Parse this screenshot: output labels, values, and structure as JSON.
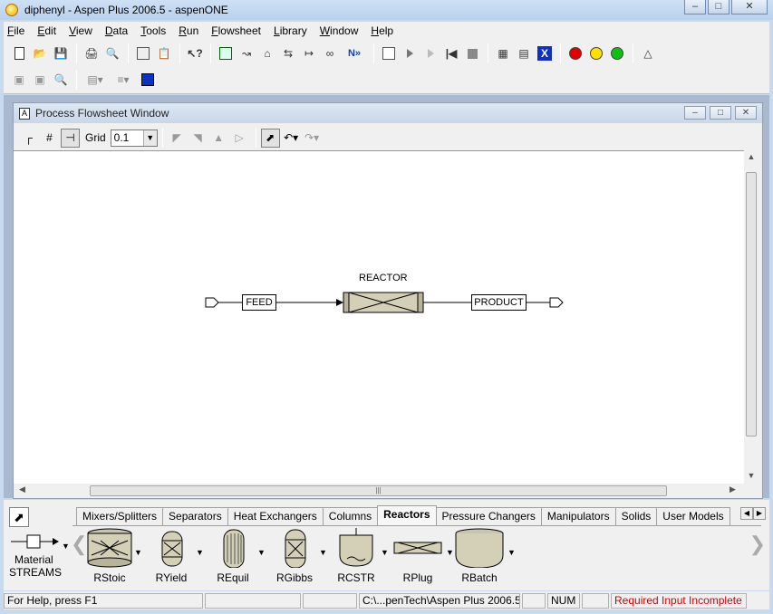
{
  "window": {
    "title": "diphenyl - Aspen Plus 2006.5 - aspenONE",
    "controls": {
      "minimize": "–",
      "maximize": "□",
      "close": "✕"
    }
  },
  "menubar": {
    "items": [
      "File",
      "Edit",
      "View",
      "Data",
      "Tools",
      "Run",
      "Flowsheet",
      "Library",
      "Window",
      "Help"
    ]
  },
  "toolbar": {
    "next_label": "N»",
    "icons": [
      "new-icon",
      "open-icon",
      "save-icon",
      "print-icon",
      "print-preview-icon",
      "copy-icon",
      "paste-icon",
      "whats-this-icon",
      "data-browser-icon",
      "stream-icon",
      "block-icon",
      "input-icon",
      "results-icon",
      "plot-icon",
      "next-icon",
      "control-panel-icon",
      "run-icon",
      "step-icon",
      "reinit-icon",
      "stop-icon",
      "results-summary-icon",
      "report-icon",
      "check-results-icon",
      "status-red-icon",
      "status-yellow-icon",
      "status-green-icon",
      "help-icon"
    ],
    "status_colors": {
      "red": "#e00000",
      "yellow": "#ffe000",
      "green": "#10c010",
      "blue": "#1030c0"
    }
  },
  "flowsheet_window": {
    "title": "Process Flowsheet Window",
    "grid_label": "Grid",
    "grid_value": "0.1",
    "blocks": [
      {
        "name": "REACTOR",
        "type": "RPlug"
      }
    ],
    "streams": [
      {
        "name": "FEED",
        "role": "inlet"
      },
      {
        "name": "PRODUCT",
        "role": "outlet"
      }
    ],
    "scroll_grip": "|||"
  },
  "model_library": {
    "tabs": [
      "Mixers/Splitters",
      "Separators",
      "Heat Exchangers",
      "Columns",
      "Reactors",
      "Pressure Changers",
      "Manipulators",
      "Solids",
      "User Models"
    ],
    "active_tab": "Reactors",
    "streams_item": {
      "label1": "Material",
      "label2": "STREAMS"
    },
    "models": [
      "RStoic",
      "RYield",
      "REquil",
      "RGibbs",
      "RCSTR",
      "RPlug",
      "RBatch"
    ]
  },
  "statusbar": {
    "help": "For Help, press F1",
    "path": "C:\\...penTech\\Aspen Plus 2006.5",
    "num": "NUM",
    "warning": "Required Input Incomplete"
  }
}
